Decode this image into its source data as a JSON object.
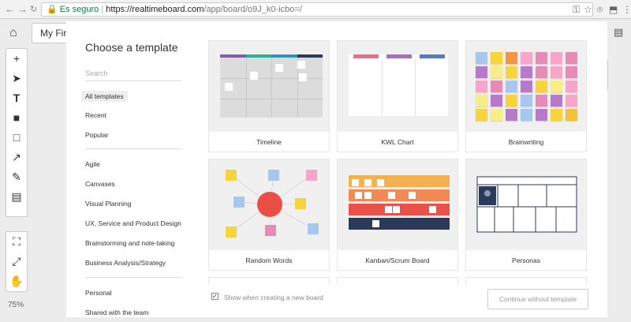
{
  "browser": {
    "secure_label": "Es seguro",
    "url_host": "https://realtimeboard.com",
    "url_path": "/app/board/o9J_k0-icbo=/"
  },
  "board": {
    "name": "My First Board",
    "zoom": "75%"
  },
  "modal": {
    "title": "Choose a template",
    "search_placeholder": "Search",
    "categories_top": [
      "All templates",
      "Recent",
      "Popular"
    ],
    "categories_main": [
      "Agile",
      "Canvases",
      "Visual Planning",
      "UX, Service and Product Design",
      "Brainstorming and note-taking",
      "Business Analysis/Strategy"
    ],
    "categories_bottom": [
      "Personal",
      "Shared with the team"
    ],
    "templates": [
      {
        "name": "Timeline"
      },
      {
        "name": "KWL Chart"
      },
      {
        "name": "Brainwriting"
      },
      {
        "name": "Random Words"
      },
      {
        "name": "Kanban/Scrum Board"
      },
      {
        "name": "Personas"
      }
    ],
    "footer": {
      "checkbox_label": "Show when creating a new board",
      "checkbox_checked": true,
      "continue_label": "Continue without template"
    }
  },
  "colors": {
    "kwl_bars": [
      "#ee6c84",
      "#a86cc8",
      "#4b7ec8"
    ],
    "timeline_bars": [
      "#7e5fb0",
      "#2bb39a",
      "#2d95c4",
      "#2d3a5a"
    ],
    "kanban_rows": [
      "#f3b252",
      "#f28a57",
      "#e8524b",
      "#2c3a5a"
    ],
    "random_center": "#ea4f47",
    "sticky": [
      "#f8d43c",
      "#f29545",
      "#f6a6c9",
      "#e68bb5",
      "#b57bc9",
      "#f7ee8a",
      "#f3c23a",
      "#a8c7ef"
    ]
  }
}
